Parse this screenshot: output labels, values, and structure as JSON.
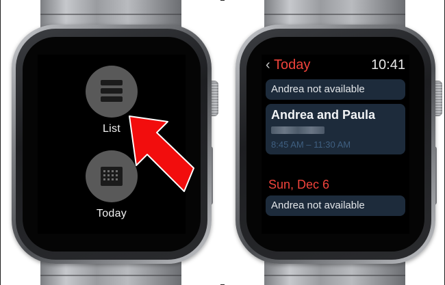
{
  "left_watch": {
    "menu": [
      {
        "label": "List",
        "icon": "list-icon"
      },
      {
        "label": "Today",
        "icon": "calendar-icon"
      }
    ],
    "annotation": {
      "type": "arrow",
      "color": "#f20d0d",
      "points_to": "List"
    }
  },
  "right_watch": {
    "header": {
      "back_chevron": "‹",
      "back_label": "Today",
      "time": "10:41"
    },
    "sections": [
      {
        "items": [
          {
            "type": "availability",
            "text": "Andrea not available"
          },
          {
            "type": "event",
            "title": "Andrea and Paula",
            "location": "",
            "time": "8:45 AM – 11:30 AM"
          }
        ]
      },
      {
        "date": "Sun, Dec 6",
        "items": [
          {
            "type": "availability",
            "text": "Andrea not available"
          }
        ]
      }
    ]
  },
  "colors": {
    "accent_red": "#f0433b",
    "card_bg": "#1d2b3b",
    "arrow_red": "#f20d0d"
  }
}
